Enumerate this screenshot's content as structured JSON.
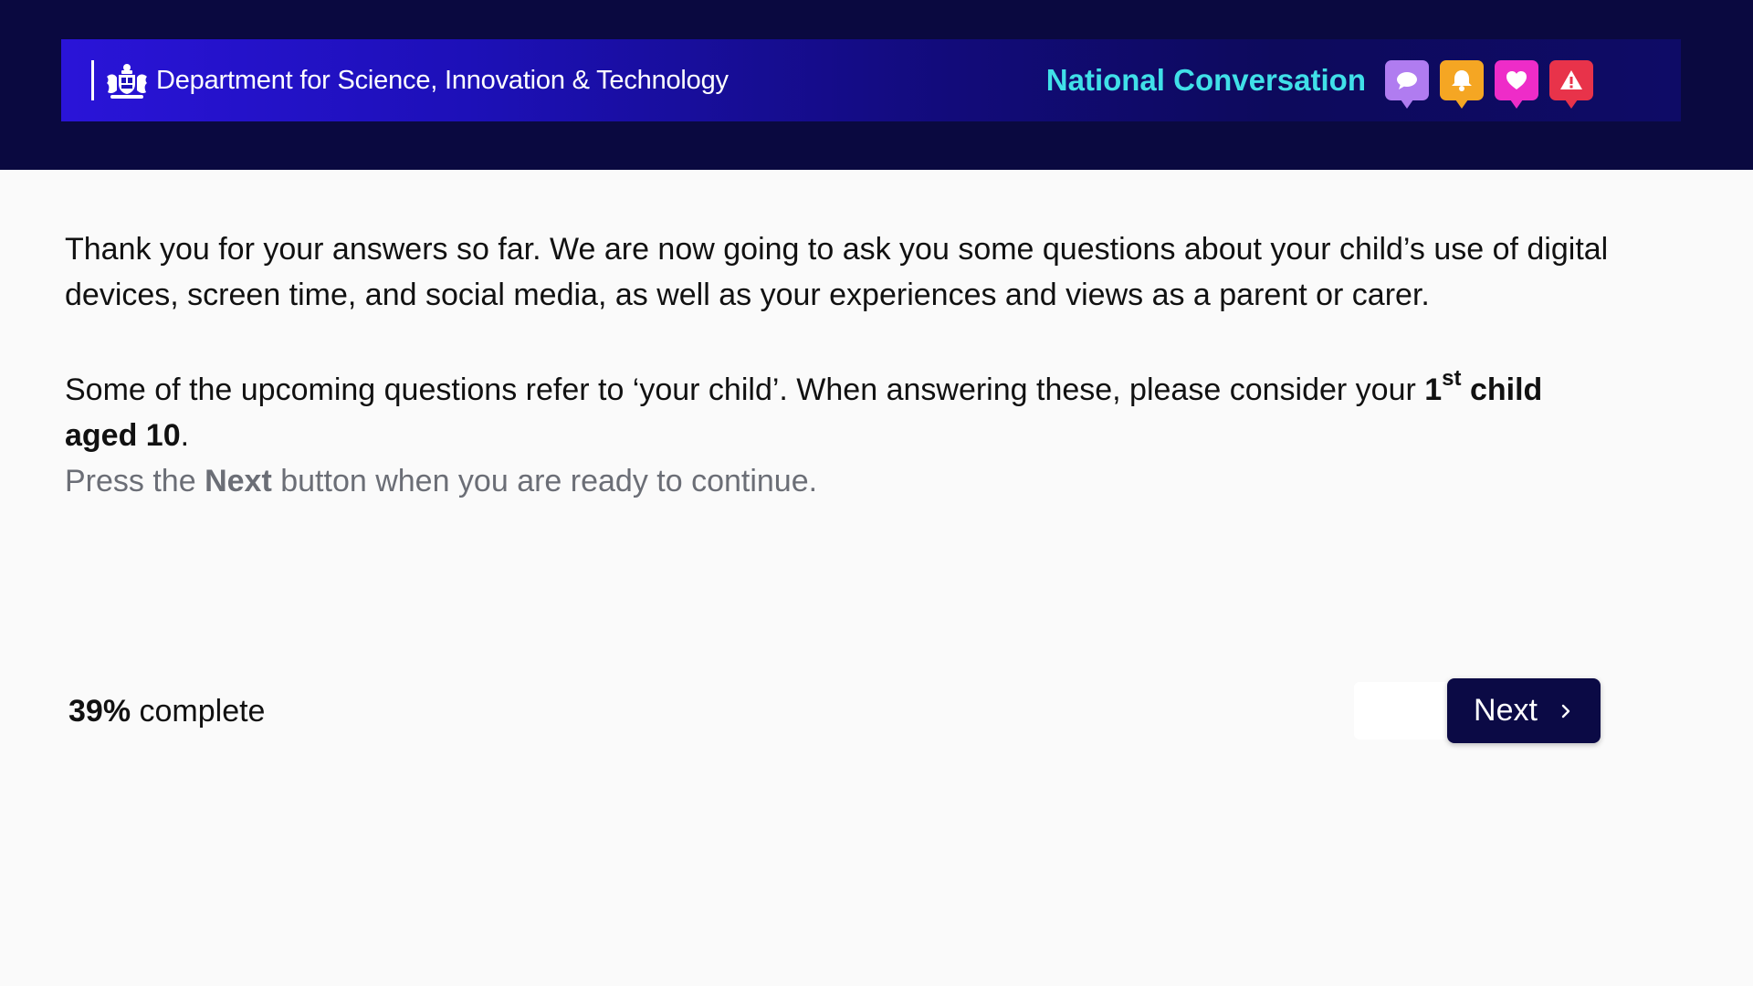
{
  "header": {
    "department": "Department for Science, Innovation & Technology",
    "brand": "National Conversation",
    "brand_color": "#40e0e8",
    "icons": [
      {
        "name": "chat-bubble-icon",
        "color": "#b07cf0"
      },
      {
        "name": "bell-icon",
        "color": "#f5a623"
      },
      {
        "name": "heart-icon",
        "color": "#ee2cc8"
      },
      {
        "name": "warning-icon",
        "color": "#e8334a"
      }
    ]
  },
  "content": {
    "intro": "Thank you for your answers so far. We are now going to ask you some questions about your child’s use of digital devices, screen time, and social media, as well as your experiences and views as a parent or carer.",
    "child_prefix": "Some of the upcoming questions refer to ‘your child’. When answering these, please consider your ",
    "child_ordinal": "1",
    "child_ordinal_suffix": "st",
    "child_bold": " child aged 10",
    "child_end": ".",
    "press_prefix": "Press the ",
    "press_bold": "Next",
    "press_suffix": " button when you are ready to continue."
  },
  "footer": {
    "progress_value": "39%",
    "progress_label": " complete",
    "next_label": "Next"
  }
}
